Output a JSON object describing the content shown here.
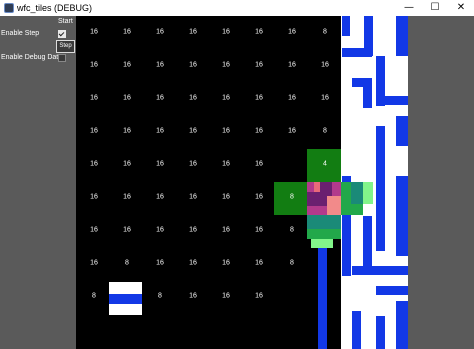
{
  "window": {
    "title": "wfc_tiles (DEBUG)",
    "minimize_icon": "—",
    "maximize_icon": "☐",
    "close_icon": "✕"
  },
  "panel": {
    "start_label": "Start",
    "enable_step_label": "Enable Step",
    "enable_step_checked": true,
    "step_button_label": "Step",
    "enable_debug_label": "Enable Debug Data",
    "enable_debug_checked": false
  },
  "grid": {
    "counts": [
      [
        "16",
        "16",
        "16",
        "16",
        "16",
        "16",
        "16",
        "8"
      ],
      [
        "16",
        "16",
        "16",
        "16",
        "16",
        "16",
        "16",
        "16"
      ],
      [
        "16",
        "16",
        "16",
        "16",
        "16",
        "16",
        "16",
        "16"
      ],
      [
        "16",
        "16",
        "16",
        "16",
        "16",
        "16",
        "16",
        "8"
      ],
      [
        "16",
        "16",
        "16",
        "16",
        "16",
        "16",
        "",
        "4"
      ],
      [
        "16",
        "16",
        "16",
        "16",
        "16",
        "16",
        "8",
        ""
      ],
      [
        "16",
        "16",
        "16",
        "16",
        "16",
        "16",
        "8",
        ""
      ],
      [
        "16",
        "8",
        "16",
        "16",
        "16",
        "16",
        "8",
        ""
      ],
      [
        "8",
        "",
        "8",
        "16",
        "16",
        "16",
        "",
        ""
      ],
      [
        "",
        "",
        "",
        "",
        "",
        "",
        "",
        ""
      ]
    ],
    "colors": {
      "background": "#000000",
      "white": "#ffffff",
      "blue": "#1238e6",
      "dark_green": "#127d12",
      "green": "#22a84a",
      "light_green": "#82f58a",
      "teal": "#1a8a78",
      "purple": "#6a2070",
      "magenta": "#b23a8c",
      "pink": "#f28a8a",
      "salmon": "#e86a7a"
    }
  }
}
